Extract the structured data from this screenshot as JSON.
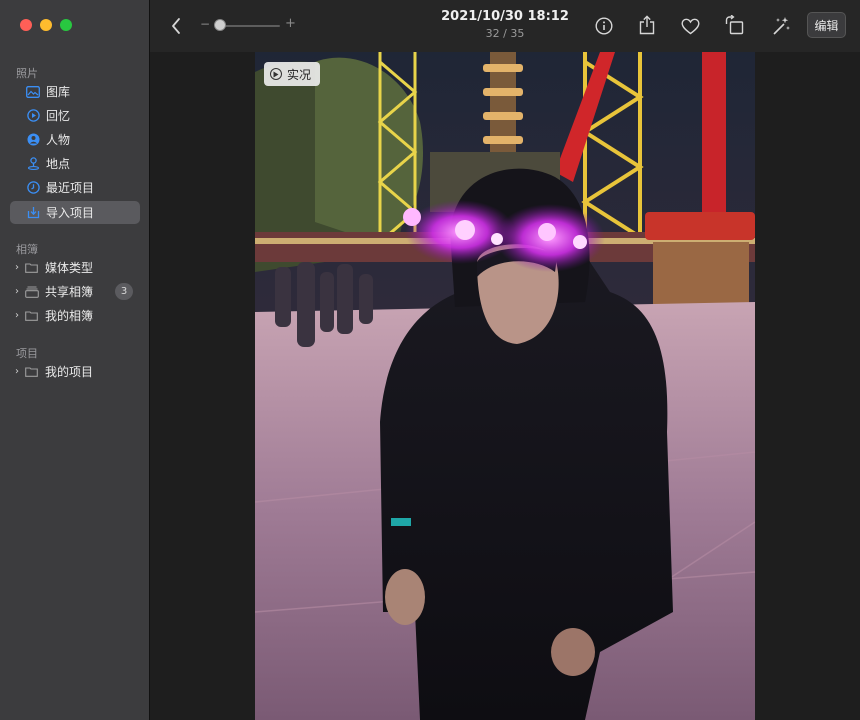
{
  "window": {
    "title": "2021/10/30 18:12",
    "subtitle": "32 / 35"
  },
  "toolbar": {
    "back_icon": "chevron-left-icon",
    "zoom_minus": "−",
    "zoom_plus": "+",
    "zoom_level": 0.0,
    "info_icon": "info-icon",
    "share_icon": "share-icon",
    "favorite_icon": "heart-icon",
    "rotate_icon": "rotate-icon",
    "enhance_icon": "magic-wand-icon",
    "edit_label": "编辑"
  },
  "sidebar": {
    "photos_section": "照片",
    "photos_items": [
      {
        "label": "图库",
        "icon": "library-icon"
      },
      {
        "label": "回忆",
        "icon": "memories-icon"
      },
      {
        "label": "人物",
        "icon": "people-icon"
      },
      {
        "label": "地点",
        "icon": "places-icon"
      },
      {
        "label": "最近项目",
        "icon": "recents-icon"
      },
      {
        "label": "导入项目",
        "icon": "imports-icon",
        "selected": true
      }
    ],
    "albums_section": "相簿",
    "albums_items": [
      {
        "label": "媒体类型",
        "icon": "folder-icon"
      },
      {
        "label": "共享相簿",
        "icon": "shared-album-icon",
        "badge": "3"
      },
      {
        "label": "我的相簿",
        "icon": "folder-icon"
      }
    ],
    "projects_section": "项目",
    "projects_items": [
      {
        "label": "我的项目",
        "icon": "folder-icon"
      }
    ]
  },
  "photo": {
    "live_label": "实况"
  },
  "colors": {
    "accent": "#3b8ff5",
    "sidebar_bg": "#3c3c3e",
    "selected_bg": "#5a5a5e"
  }
}
